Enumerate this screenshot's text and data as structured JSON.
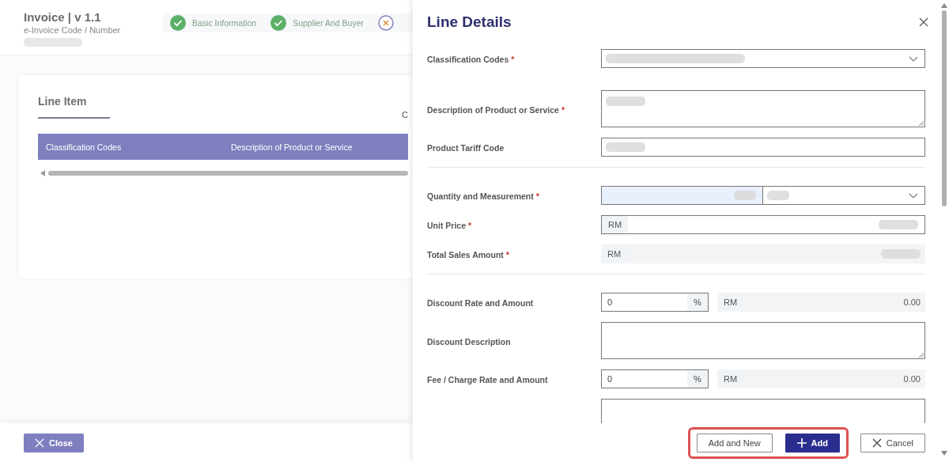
{
  "header": {
    "title": "Invoice | v 1.1",
    "subtitle": "e-Invoice Code / Number",
    "number_redacted": true
  },
  "steps": [
    {
      "label": "Basic Information",
      "completed": true
    },
    {
      "label": "Supplier And Buyer",
      "completed": true
    },
    {
      "completed": false
    }
  ],
  "card": {
    "tab": "Line Item",
    "cut_text": "C",
    "table": {
      "columns": [
        "Classification Codes",
        "Description of Product or Service"
      ]
    }
  },
  "footer": {
    "close_button": {
      "label": "Close"
    }
  },
  "panel": {
    "title": "Line Details",
    "required_mark": "*",
    "rows": [
      {
        "kind": "select",
        "label": "Classification Codes",
        "required": true,
        "redacted": true
      },
      {
        "kind": "textarea",
        "label": "Description of Product or Service",
        "required": true,
        "redacted": true
      },
      {
        "kind": "text",
        "label": "Product Tariff Code",
        "required": false,
        "redacted": true
      },
      {
        "kind": "divider"
      },
      {
        "kind": "quantity",
        "label": "Quantity and Measurement",
        "required": true,
        "redacted": true,
        "focused": true
      },
      {
        "kind": "currency",
        "label": "Unit Price",
        "required": true,
        "prefix": "RM",
        "redacted": true
      },
      {
        "kind": "readonly_currency",
        "label": "Total Sales Amount",
        "required": true,
        "prefix": "RM",
        "redacted": true
      },
      {
        "kind": "divider"
      },
      {
        "kind": "rate",
        "label": "Discount Rate and Amount",
        "required": false,
        "value": "0",
        "suffix": "%",
        "prefix": "RM",
        "amount": "0.00"
      },
      {
        "kind": "textarea",
        "label": "Discount Description",
        "required": false,
        "redacted": false
      },
      {
        "kind": "rate",
        "label": "Fee / Charge Rate and Amount",
        "required": false,
        "value": "0",
        "suffix": "%",
        "prefix": "RM",
        "amount": "0.00"
      },
      {
        "kind": "textarea",
        "required": false,
        "redacted": false
      }
    ],
    "buttons": [
      {
        "label": "Add and New",
        "kind": "secondary",
        "highlighted": true
      },
      {
        "label": "Add",
        "kind": "primary",
        "highlighted": true
      },
      {
        "label": "Cancel",
        "kind": "cancel",
        "highlighted": false
      }
    ]
  }
}
